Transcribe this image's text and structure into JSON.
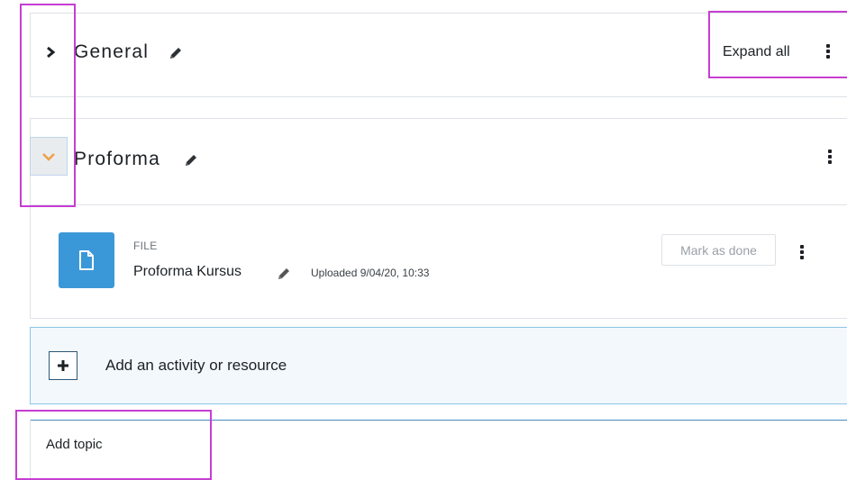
{
  "sections": [
    {
      "title": "General",
      "expanded": false
    },
    {
      "title": "Proforma",
      "expanded": true
    }
  ],
  "header": {
    "expand_all_label": "Expand all"
  },
  "activity": {
    "type_label": "FILE",
    "name": "Proforma Kursus",
    "uploaded": "Uploaded 9/04/20, 10:33",
    "mark_done_label": "Mark as done"
  },
  "add_activity": {
    "label": "Add an activity or resource"
  },
  "add_topic": {
    "label": "Add topic"
  },
  "colors": {
    "accent": "#3b98d8",
    "chevron_active": "#f0a04b",
    "highlight": "#c63ed2",
    "border": "#dee2e6"
  },
  "icons": [
    "chevron-right-icon",
    "chevron-down-icon",
    "pencil-icon",
    "kebab-menu-icon",
    "file-icon",
    "plus-icon"
  ]
}
